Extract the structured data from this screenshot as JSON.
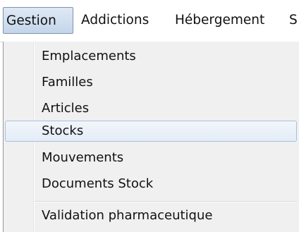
{
  "menubar": {
    "items": [
      {
        "label": "Gestion"
      },
      {
        "label": "Addictions"
      },
      {
        "label": "Hébergement"
      },
      {
        "label": "S"
      }
    ]
  },
  "dropdown": {
    "items": [
      {
        "label": "Emplacements"
      },
      {
        "label": "Familles"
      },
      {
        "label": "Articles"
      },
      {
        "label": "Stocks"
      },
      {
        "label": "Mouvements"
      },
      {
        "label": "Documents Stock"
      },
      {
        "label": "Validation pharmaceutique"
      }
    ],
    "highlighted_item": "Stocks"
  },
  "colors": {
    "active_menu_bg": "#c4d5ea",
    "hover_item_bg": "#e4ecf7",
    "dropdown_bg": "#f0f0f0"
  }
}
